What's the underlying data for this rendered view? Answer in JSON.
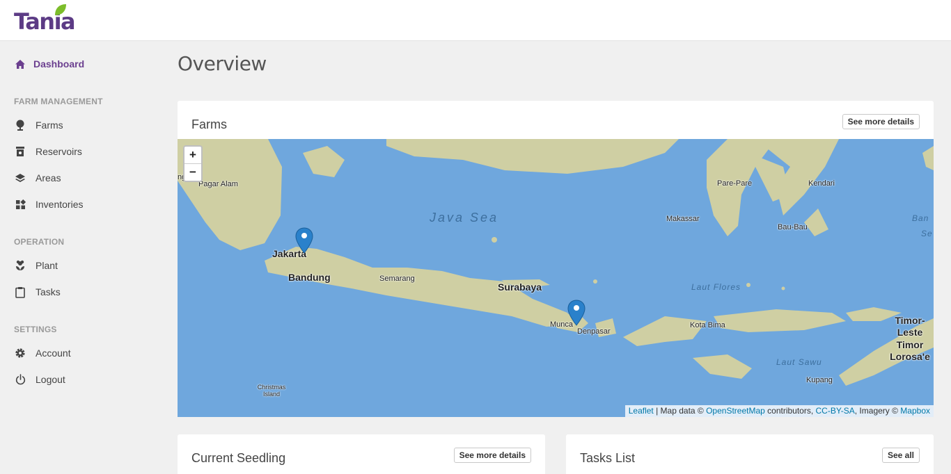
{
  "brand": {
    "name": "Tania"
  },
  "sidebar": {
    "dashboard": "Dashboard",
    "sections": {
      "farm_management": "FARM MANAGEMENT",
      "operation": "OPERATION",
      "settings": "SETTINGS"
    },
    "farm_items": [
      "Farms",
      "Reservoirs",
      "Areas",
      "Inventories"
    ],
    "operation_items": [
      "Plant",
      "Tasks"
    ],
    "settings_items": [
      "Account",
      "Logout"
    ]
  },
  "main": {
    "title": "Overview",
    "farms_card": {
      "title": "Farms",
      "button": "See more details",
      "map": {
        "zoom_in": "+",
        "zoom_out": "−",
        "labels": {
          "pagar_alam": "Pagar Alam",
          "ng": "ng",
          "java_sea": "Java Sea",
          "jakarta": "Jakarta",
          "bandung": "Bandung",
          "semarang": "Semarang",
          "surabaya": "Surabaya",
          "makassar": "Makassar",
          "pare_pare": "Pare-Pare",
          "kendari": "Kendari",
          "bau_bau": "Bau-Bau",
          "laut_flores": "Laut Flores",
          "kota_bima": "Kota Bima",
          "munca": "Munca",
          "denpasar": "Denpasar",
          "christmas_island": "Christmas Island",
          "laut_sawu": "Laut Sawu",
          "kupang": "Kupang",
          "timor_leste": "Timor-Leste",
          "timor_lorosae": "Timor Lorosa'e",
          "ban": "Ban",
          "se": "Se"
        },
        "attribution": {
          "leaflet": "Leaflet",
          "map_data": " | Map data © ",
          "osm": "OpenStreetMap",
          "contributors": " contributors, ",
          "license": "CC-BY-SA",
          "imagery": ", Imagery © ",
          "mapbox": "Mapbox"
        }
      }
    },
    "seedling_card": {
      "title": "Current Seedling",
      "button": "See more details"
    },
    "tasks_card": {
      "title": "Tasks List",
      "button": "See all"
    }
  },
  "colors": {
    "brand": "#5c3b85",
    "active": "#6b3f8f",
    "leaf": "#7cbd2a",
    "sea": "#6fa7dd",
    "land": "#c9c9a0"
  }
}
